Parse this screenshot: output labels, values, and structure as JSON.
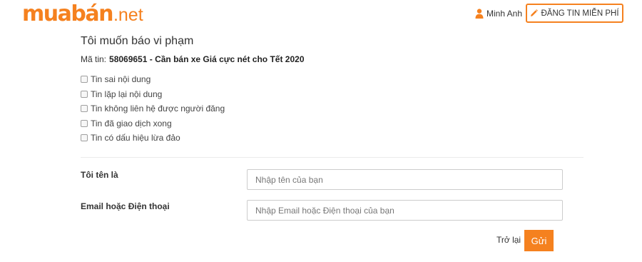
{
  "header": {
    "logo_brand": "muabán",
    "logo_tld": ".net",
    "user_name": "Minh Anh",
    "post_button_label": "ĐĂNG TIN MIỄN PHÍ",
    "user_icon": "user-icon",
    "pencil_icon": "pencil-icon"
  },
  "report": {
    "title": "Tôi muốn báo vi phạm",
    "listing_label": "Mã tin:",
    "listing_value": "58069651 - Cần bán xe Giá cực nét cho Tết 2020",
    "reasons": [
      "Tin sai nội dung",
      "Tin lặp lại nội dung",
      "Tin không liên hệ được người đăng",
      "Tin đã giao dịch xong",
      "Tin có dấu hiệu lừa đảo"
    ]
  },
  "form": {
    "name_label": "Tôi tên là",
    "name_placeholder": "Nhập tên của bạn",
    "contact_label": "Email hoặc Điện thoại",
    "contact_placeholder": "Nhập Email hoặc Điện thoại của bạn",
    "back_label": "Trở lại",
    "send_label": "Gửi"
  },
  "colors": {
    "accent": "#f5811f",
    "text": "#333333",
    "border": "#cccccc"
  }
}
